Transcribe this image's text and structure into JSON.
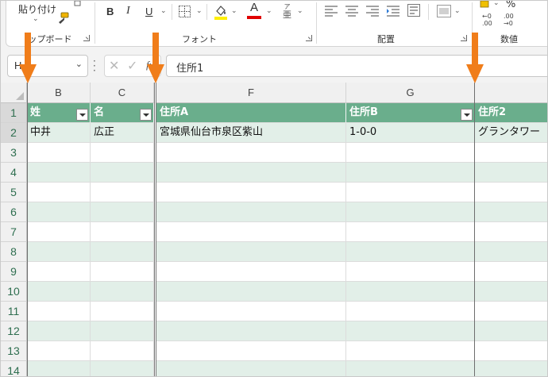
{
  "ribbon": {
    "paste_label": "貼り付け",
    "clipboard_label": "ップボード",
    "font_label": "フォント",
    "align_label": "配置",
    "number_label": "数値",
    "bold": "B",
    "italic": "I",
    "underline": "U",
    "font_color_letter": "A",
    "highlight_color": "#ffef00",
    "font_color": "#e00000",
    "phonetic_top": "ア",
    "phonetic_bottom": "亜",
    "percent_label": "%",
    "dec_inc": "←0\n.00",
    "dec_dec": ".00\n→0"
  },
  "formula_bar": {
    "name_box": "H",
    "value": "住所1"
  },
  "columns": [
    {
      "letter": "B"
    },
    {
      "letter": "C"
    },
    {
      "letter": "F"
    },
    {
      "letter": "G"
    }
  ],
  "rows": [
    "1",
    "2",
    "3",
    "4",
    "5",
    "6",
    "7",
    "8",
    "9",
    "10",
    "11",
    "12",
    "13",
    "14"
  ],
  "table": {
    "headers": [
      "姓",
      "名",
      "住所A",
      "住所B",
      "住所2"
    ],
    "row2": [
      "中井",
      "広正",
      "宮城県仙台市泉区紫山",
      "1-0-0",
      "グランタワー"
    ]
  },
  "colors": {
    "header_green": "#6aae8c",
    "band_green": "#e2efe8",
    "arrow_orange": "#f07d1a",
    "row_number_green": "#2e6e4f"
  }
}
